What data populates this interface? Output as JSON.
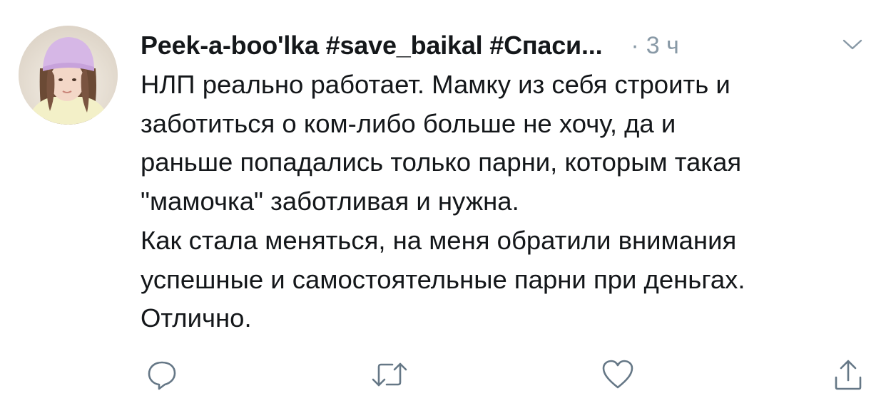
{
  "tweet": {
    "display_name": "Peek-a-boo'lka #save_baikal #Спаси...",
    "separator": "·",
    "timestamp": "3 ч",
    "text_lines": [
      "НЛП реально работает. Мамку из себя строить и",
      "заботиться о ком-либо больше не хочу,  да и",
      "раньше попадались только парни,  которым такая",
      "\"мамочка\" заботливая и нужна.",
      "Как стала меняться, на меня обратили внимания",
      "успешные и самостоятельные парни при деньгах.",
      "Отлично."
    ]
  },
  "actions": {
    "reply_icon": "reply-icon",
    "retweet_icon": "retweet-icon",
    "like_icon": "heart-icon",
    "share_icon": "share-icon"
  },
  "colors": {
    "text": "#14171a",
    "muted": "#8899a6",
    "icon": "#657786"
  }
}
